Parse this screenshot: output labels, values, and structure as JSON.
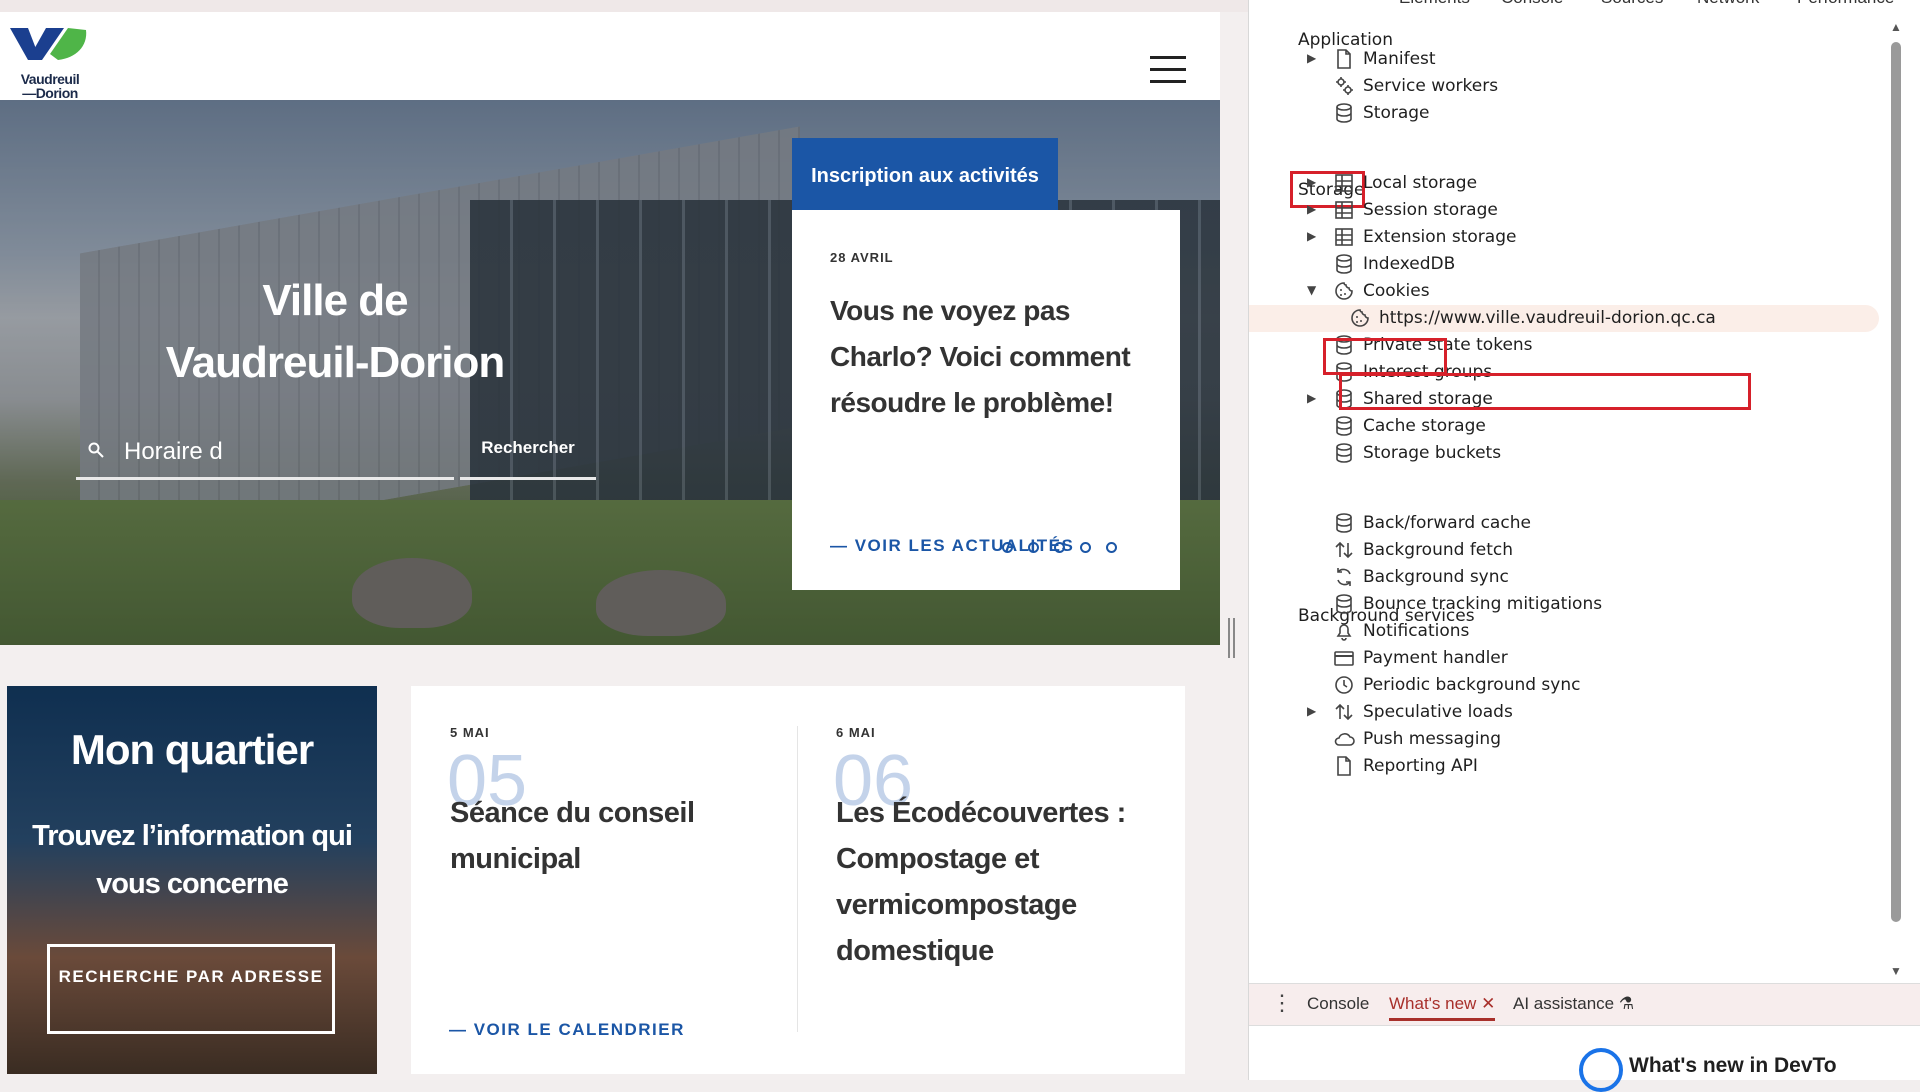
{
  "website": {
    "logo": {
      "line1": "Vaudreuil",
      "line2": "—Dorion"
    },
    "hero": {
      "title_line1": "Ville de",
      "title_line2": "Vaudreuil-Dorion",
      "search_value": "Horaire d",
      "search_button": "Rechercher"
    },
    "news": {
      "tab_label": "Inscription aux activités",
      "date": "28 AVRIL",
      "title": "Vous ne voyez pas Charlo? Voici comment résoudre le problème!",
      "link": "— VOIR LES ACTUALITÉS"
    },
    "quartier": {
      "title": "Mon quartier",
      "subtitle": "Trouvez l’information qui vous concerne",
      "button": "RECHERCHE PAR ADRESSE"
    },
    "events": [
      {
        "date": "5 MAI",
        "day": "05",
        "title": "Séance du conseil municipal"
      },
      {
        "date": "6 MAI",
        "day": "06",
        "title": "Les Écodécouvertes : Compostage et vermicompostage domestique"
      }
    ],
    "calendar_link": "— VOIR LE CALENDRIER"
  },
  "devtools": {
    "tabs": [
      "Elements",
      "Console",
      "Sources",
      "Network",
      "Performance"
    ],
    "sections": {
      "application": "Application",
      "storage": "Storage",
      "background": "Background services"
    },
    "application_items": [
      {
        "label": "Manifest",
        "icon": "file-icon",
        "expandable": true
      },
      {
        "label": "Service workers",
        "icon": "gears-icon",
        "expandable": false
      },
      {
        "label": "Storage",
        "icon": "database-icon",
        "expandable": false
      }
    ],
    "storage_items": [
      {
        "label": "Local storage",
        "icon": "table-icon",
        "expandable": true
      },
      {
        "label": "Session storage",
        "icon": "table-icon",
        "expandable": true
      },
      {
        "label": "Extension storage",
        "icon": "table-icon",
        "expandable": true
      },
      {
        "label": "IndexedDB",
        "icon": "database-icon",
        "expandable": false
      },
      {
        "label": "Cookies",
        "icon": "cookie-icon",
        "expandable": true,
        "expanded": true
      },
      {
        "label": "https://www.ville.vaudreuil-dorion.qc.ca",
        "icon": "cookie-icon",
        "child": true,
        "selected": true
      },
      {
        "label": "Private state tokens",
        "icon": "database-icon",
        "expandable": false
      },
      {
        "label": "Interest groups",
        "icon": "database-icon",
        "expandable": false
      },
      {
        "label": "Shared storage",
        "icon": "database-icon",
        "expandable": true
      },
      {
        "label": "Cache storage",
        "icon": "database-icon",
        "expandable": false
      },
      {
        "label": "Storage buckets",
        "icon": "database-icon",
        "expandable": false
      }
    ],
    "background_items": [
      {
        "label": "Back/forward cache",
        "icon": "database-icon"
      },
      {
        "label": "Background fetch",
        "icon": "updown-arrows-icon"
      },
      {
        "label": "Background sync",
        "icon": "sync-icon"
      },
      {
        "label": "Bounce tracking mitigations",
        "icon": "database-icon"
      },
      {
        "label": "Notifications",
        "icon": "bell-icon"
      },
      {
        "label": "Payment handler",
        "icon": "card-icon"
      },
      {
        "label": "Periodic background sync",
        "icon": "clock-icon"
      },
      {
        "label": "Speculative loads",
        "icon": "updown-arrows-icon",
        "expandable": true
      },
      {
        "label": "Push messaging",
        "icon": "cloud-icon"
      },
      {
        "label": "Reporting API",
        "icon": "file-icon"
      }
    ],
    "drawer": {
      "tabs": [
        "Console",
        "What's new",
        "AI assistance"
      ],
      "active_tab": "What's new",
      "content_title": "What's new in DevTo"
    },
    "colors": {
      "highlight_box": "#d6202a",
      "accent": "#a8302b",
      "link_blue": "#1b56a6"
    }
  }
}
